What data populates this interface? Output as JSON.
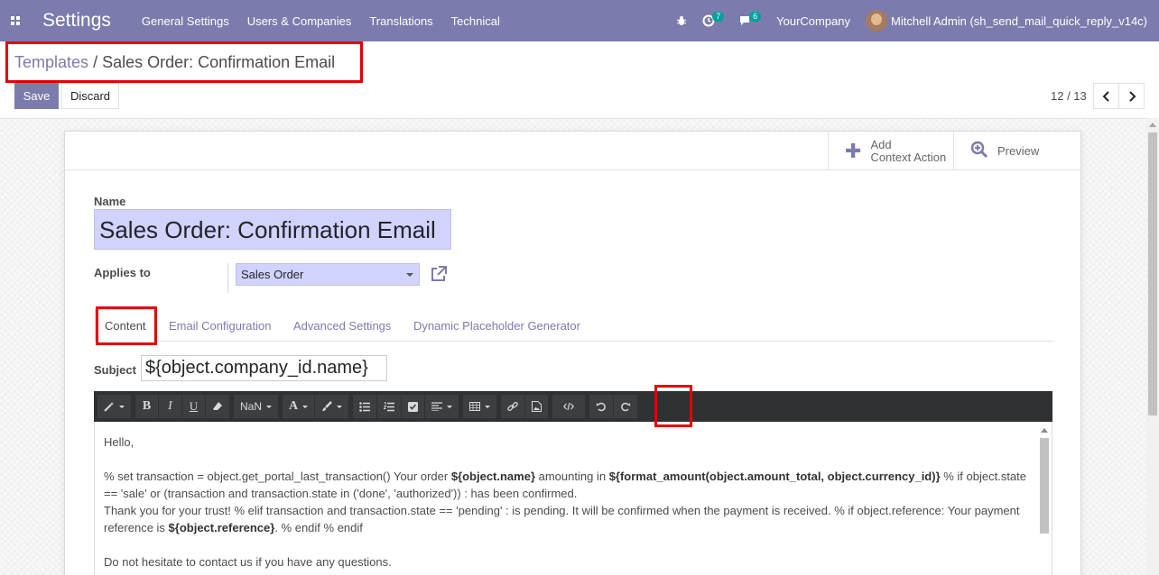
{
  "navbar": {
    "app_title": "Settings",
    "menu": [
      "General Settings",
      "Users & Companies",
      "Translations",
      "Technical"
    ],
    "activity_count": "7",
    "messages_count": "6",
    "company": "YourCompany",
    "user": "Mitchell Admin (sh_send_mail_quick_reply_v14c)"
  },
  "breadcrumb": {
    "parent": "Templates",
    "separator": "/",
    "current": "Sales Order: Confirmation Email"
  },
  "buttons": {
    "save": "Save",
    "discard": "Discard"
  },
  "pager": {
    "value": "12 / 13",
    "prev": "‹",
    "next": "›"
  },
  "smart_buttons": {
    "add_context": [
      "Add",
      "Context Action"
    ],
    "preview": "Preview"
  },
  "form": {
    "name_label": "Name",
    "name_value": "Sales Order: Confirmation Email",
    "applies_label": "Applies to",
    "applies_value": "Sales Order"
  },
  "tabs": [
    "Content",
    "Email Configuration",
    "Advanced Settings",
    "Dynamic Placeholder Generator"
  ],
  "subject": {
    "label": "Subject",
    "value": "${object.company_id.name}"
  },
  "toolbar": {
    "font_size": "NaN",
    "font_color": "A"
  },
  "editor": {
    "greeting": "Hello,",
    "p1_a": "% set transaction = object.get_portal_last_transaction() Your order ",
    "p1_b": "${object.name}",
    "p1_c": " amounting in ",
    "p1_d": "${format_amount(object.amount_total, object.currency_id)}",
    "p1_e": " % if object.state == 'sale' or (transaction and transaction.state in ('done', 'authorized')) : has been confirmed.",
    "p2_a": "Thank you for your trust! % elif transaction and transaction.state == 'pending' : is pending. It will be confirmed when the payment is received. % if object.reference: Your payment reference is ",
    "p2_b": "${object.reference}",
    "p2_c": ". % endif % endif",
    "closing": "Do not hesitate to contact us if you have any questions."
  },
  "colors": {
    "brand": "#7c7bad",
    "toolbar": "#2f3133",
    "highlight": "#e50000",
    "input_bg": "#d2d2ff"
  }
}
